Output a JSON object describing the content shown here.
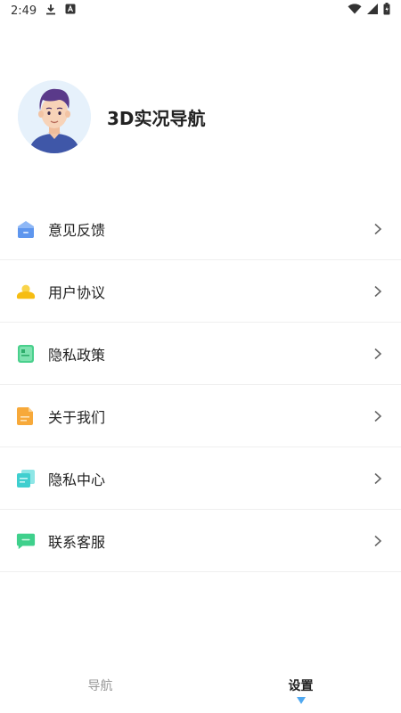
{
  "status_bar": {
    "time": "2:49",
    "icons": [
      "download-icon",
      "a-notification-icon",
      "wifi-icon",
      "signal-icon",
      "battery-icon"
    ]
  },
  "profile": {
    "app_name": "3D实况导航"
  },
  "menu": {
    "items": [
      {
        "label": "意见反馈",
        "icon": "feedback-icon",
        "color": "#6aa3f4"
      },
      {
        "label": "用户协议",
        "icon": "agreement-icon",
        "color": "#f6c21a"
      },
      {
        "label": "隐私政策",
        "icon": "privacy-policy-icon",
        "color": "#47cf8a"
      },
      {
        "label": "关于我们",
        "icon": "about-icon",
        "color": "#f6a93b"
      },
      {
        "label": "隐私中心",
        "icon": "privacy-center-icon",
        "color": "#4fd6d6"
      },
      {
        "label": "联系客服",
        "icon": "customer-service-icon",
        "color": "#3fd08c"
      }
    ]
  },
  "bottom_nav": {
    "tabs": [
      {
        "label": "导航",
        "active": false
      },
      {
        "label": "设置",
        "active": true
      }
    ],
    "indicator_color": "#4fa8f0"
  }
}
